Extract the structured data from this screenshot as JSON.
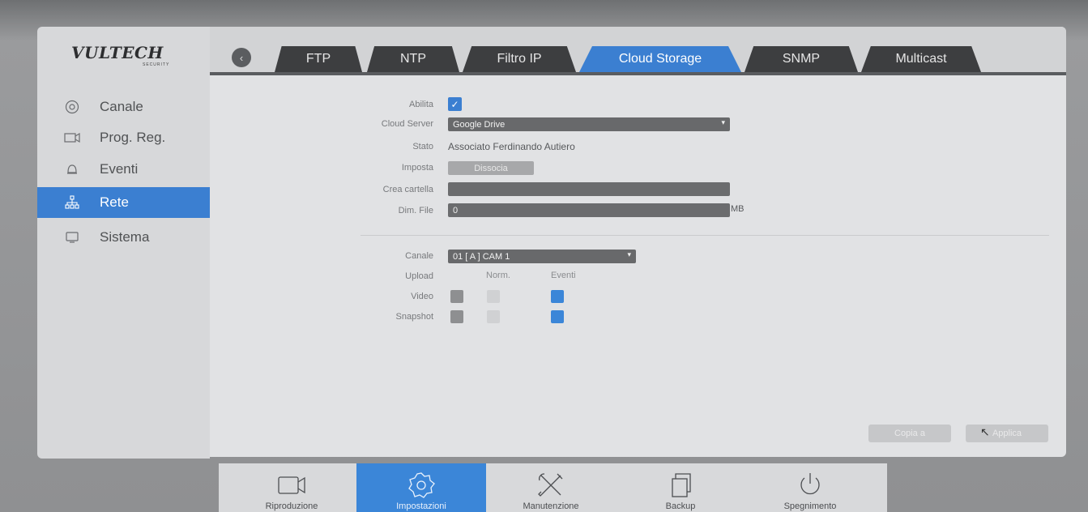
{
  "brand": {
    "logo": "VULTECH",
    "sub": "SECURITY"
  },
  "sidebar": {
    "items": [
      {
        "label": "Canale",
        "icon": "camera-circle-icon"
      },
      {
        "label": "Prog. Reg.",
        "icon": "record-schedule-icon"
      },
      {
        "label": "Eventi",
        "icon": "alarm-bell-icon"
      },
      {
        "label": "Rete",
        "icon": "network-icon",
        "active": true
      },
      {
        "label": "Sistema",
        "icon": "monitor-icon"
      }
    ]
  },
  "tabs": [
    {
      "label": "FTP"
    },
    {
      "label": "NTP"
    },
    {
      "label": "Filtro IP"
    },
    {
      "label": "Cloud Storage",
      "active": true
    },
    {
      "label": "SNMP"
    },
    {
      "label": "Multicast"
    }
  ],
  "form": {
    "enable_label": "Abilita",
    "enable_checked": true,
    "cloud_server_label": "Cloud Server",
    "cloud_server_value": "Google Drive",
    "status_label": "Stato",
    "status_value": "Associato Ferdinando Autiero",
    "setting_label": "Imposta",
    "dissocia_label": "Dissocia",
    "create_folder_label": "Crea cartella",
    "create_folder_value": "",
    "file_size_label": "Dim. File",
    "file_size_value": "0",
    "file_size_unit": "MB",
    "channel_label": "Canale",
    "channel_value": "01 [ A ] CAM 1",
    "upload_label": "Upload",
    "col_norm": "Norm.",
    "col_events": "Eventi",
    "video_label": "Video",
    "snapshot_label": "Snapshot"
  },
  "actions": {
    "copy": "Copia a",
    "apply": "Applica"
  },
  "dock": [
    {
      "label": "Riproduzione",
      "icon": "playback-camera-icon"
    },
    {
      "label": "Impostazioni",
      "icon": "settings-gear-icon",
      "active": true
    },
    {
      "label": "Manutenzione",
      "icon": "maintenance-tools-icon"
    },
    {
      "label": "Backup",
      "icon": "backup-document-icon"
    },
    {
      "label": "Spegnimento",
      "icon": "power-icon"
    }
  ],
  "colors": {
    "accent": "#3b7fd1",
    "tab_dark": "#3d3e40"
  }
}
